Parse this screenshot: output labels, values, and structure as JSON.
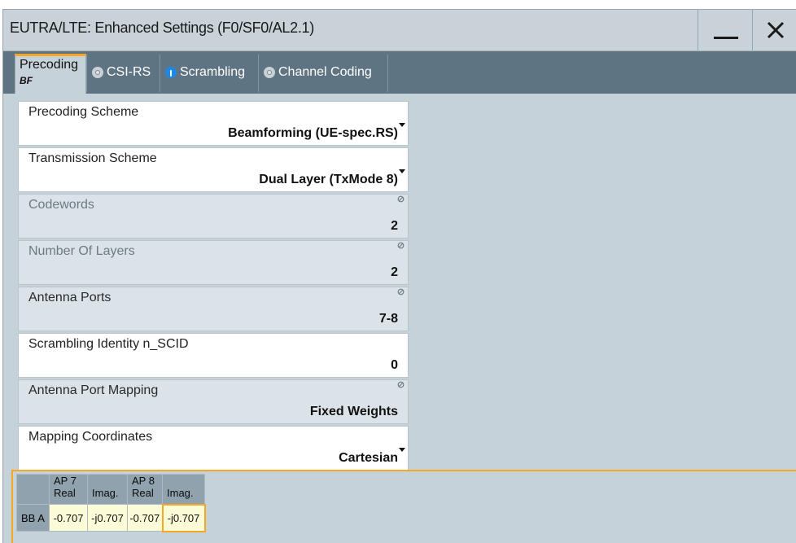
{
  "window": {
    "title": "EUTRA/LTE: Enhanced Settings (F0/SF0/AL2.1)",
    "minimize_glyph": "minimize-icon",
    "close_glyph": "close-icon"
  },
  "tabs": [
    {
      "label": "Precoding",
      "sublabel": "BF",
      "active": true
    },
    {
      "label": "CSI-RS",
      "indicator": "off"
    },
    {
      "label": "Scrambling",
      "indicator": "on"
    },
    {
      "label": "Channel Coding",
      "indicator": "off"
    }
  ],
  "fields": {
    "precoding_scheme": {
      "label": "Precoding Scheme",
      "value": "Beamforming (UE-spec.RS)"
    },
    "transmission_scheme": {
      "label": "Transmission Scheme",
      "value": "Dual Layer (TxMode 8)"
    },
    "codewords": {
      "label": "Codewords",
      "value": "2"
    },
    "number_of_layers": {
      "label": "Number Of Layers",
      "value": "2"
    },
    "antenna_ports": {
      "label": "Antenna Ports",
      "value": "7-8"
    },
    "scrambling_identity": {
      "label": "Scrambling Identity n_SCID",
      "value": "0"
    },
    "antenna_port_mapping": {
      "label": "Antenna Port Mapping",
      "value": "Fixed Weights"
    },
    "mapping_coordinates": {
      "label": "Mapping Coordinates",
      "value": "Cartesian"
    }
  },
  "matrix": {
    "columns": [
      {
        "port": "AP 7",
        "part": "Real"
      },
      {
        "port": "",
        "part": "Imag."
      },
      {
        "port": "AP 8",
        "part": "Real"
      },
      {
        "port": "",
        "part": "Imag."
      }
    ],
    "rows": [
      {
        "label": "BB A",
        "cells": [
          "-0.707",
          "-j0.707",
          "-0.707",
          "-j0.707"
        ]
      }
    ]
  },
  "colors": {
    "accent": "#f7a823",
    "tab_strip": "#5e7482",
    "panel": "#c6d2d9",
    "indicator_on": "#1e88e5",
    "matrix_cell": "#fbfbd7"
  }
}
